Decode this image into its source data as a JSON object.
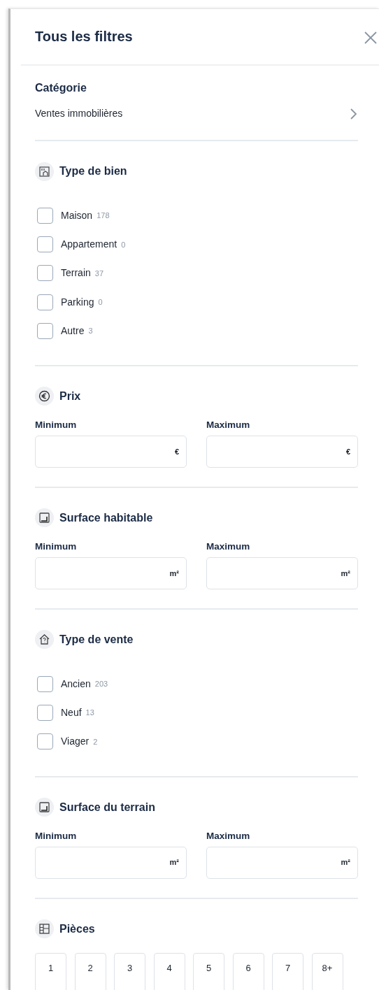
{
  "panel": {
    "title": "Tous les filtres"
  },
  "category": {
    "heading": "Catégorie",
    "value": "Ventes immobilières"
  },
  "sections": [
    {
      "kind": "checklist",
      "heading": "Type de bien",
      "items": [
        {
          "label": "Maison",
          "count": "178",
          "checked": false
        },
        {
          "label": "Appartement",
          "count": "0",
          "checked": false
        },
        {
          "label": "Terrain",
          "count": "37",
          "checked": false
        },
        {
          "label": "Parking",
          "count": "0",
          "checked": false
        },
        {
          "label": "Autre",
          "count": "3",
          "checked": false
        }
      ]
    },
    {
      "kind": "range",
      "heading": "Prix",
      "fields": [
        {
          "label": "Minimum",
          "unit": "€"
        },
        {
          "label": "Maximum",
          "unit": "€"
        }
      ]
    },
    {
      "kind": "range",
      "heading": "Surface habitable",
      "fields": [
        {
          "label": "Minimum",
          "unit": "m²"
        },
        {
          "label": "Maximum",
          "unit": "m²"
        }
      ]
    },
    {
      "kind": "checklist",
      "heading": "Type de vente",
      "items": [
        {
          "label": "Ancien",
          "count": "203",
          "checked": false
        },
        {
          "label": "Neuf",
          "count": "13",
          "checked": false
        },
        {
          "label": "Viager",
          "count": "2",
          "checked": false
        }
      ]
    },
    {
      "kind": "range",
      "heading": "Surface du terrain",
      "fields": [
        {
          "label": "Minimum",
          "unit": "m²"
        },
        {
          "label": "Maximum",
          "unit": "m²"
        }
      ]
    },
    {
      "kind": "buttons",
      "heading": "Pièces",
      "options": [
        {
          "label": "1",
          "selected": false
        },
        {
          "label": "2",
          "selected": false
        },
        {
          "label": "3",
          "selected": false
        },
        {
          "label": "4",
          "selected": false
        },
        {
          "label": "5",
          "selected": false
        },
        {
          "label": "6",
          "selected": false
        },
        {
          "label": "7",
          "selected": false
        },
        {
          "label": "8+",
          "selected": false
        }
      ]
    }
  ]
}
